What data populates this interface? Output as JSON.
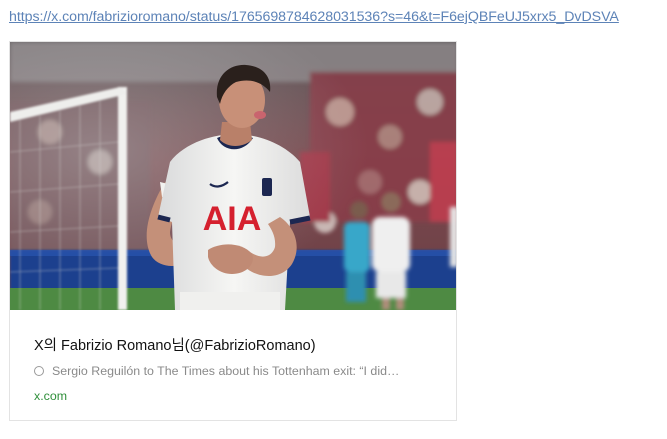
{
  "link": {
    "url_text": "https://x.com/fabrizioromano/status/1765698784628031536?s=46&t=F6ejQBFeUJ5xrx5_DvDSVA"
  },
  "preview": {
    "image": {
      "shirt_sponsor": "AIA",
      "colors": {
        "shirt": "#f4f4f2",
        "navy": "#1c2751",
        "sponsor_red": "#d5202e",
        "pitch": "#4e8a43",
        "crowd": "#7b4a4f"
      }
    },
    "title": "X의 Fabrizio Romano님(@FabrizioRomano)",
    "description_icon": "circle-icon",
    "description": "Sergio Reguilón to The Times about his Tottenham exit: “I did…",
    "domain": "x.com"
  }
}
